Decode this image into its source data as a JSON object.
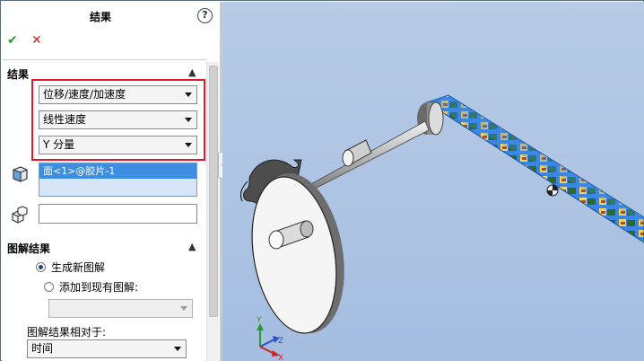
{
  "panel": {
    "title": "结果",
    "help_icon": "question-circle-icon",
    "ok_icon": "check-icon",
    "cancel_icon": "close-x-icon",
    "results_section": {
      "header": "结果",
      "result_type": "位移/速度/加速度",
      "sub_type": "线性速度",
      "component": "Y 分量",
      "selected_faces": [
        "面<1>@胶片-1"
      ],
      "reference_component": ""
    },
    "plot_section": {
      "header": "图解结果",
      "new_plot_label": "生成新图解",
      "new_plot_checked": true,
      "add_existing_label": "添加到现有图解:",
      "add_existing_checked": false,
      "existing_plot_value": "",
      "relative_to_label": "图解结果相对于:",
      "relative_to_value": "时间"
    }
  },
  "viewport": {
    "triad_labels": {
      "x": "X",
      "y": "Y",
      "z": "Z"
    }
  },
  "colors": {
    "accent_red": "#e0182a",
    "ok_green": "#2e9a2e",
    "cancel_red": "#d42020",
    "selection_blue": "#3d8ee0",
    "viewport_bg": "#b0c7e4"
  }
}
